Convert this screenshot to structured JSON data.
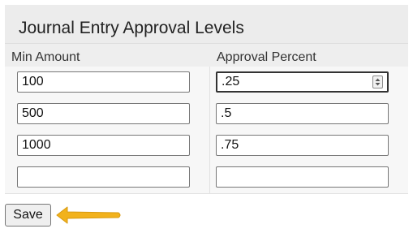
{
  "panel": {
    "title": "Journal Entry Approval Levels",
    "columns": {
      "min_amount": "Min Amount",
      "approval_percent": "Approval Percent"
    },
    "rows": [
      {
        "min_amount": "100",
        "approval_percent": ".25"
      },
      {
        "min_amount": "500",
        "approval_percent": ".5"
      },
      {
        "min_amount": "1000",
        "approval_percent": ".75"
      },
      {
        "min_amount": "",
        "approval_percent": ""
      }
    ]
  },
  "actions": {
    "save_label": "Save"
  },
  "colors": {
    "arrow": "#f2b21c",
    "panel_background": "#ececec"
  },
  "icons": {
    "number_spinner": "spinner-icon",
    "pointer_arrow": "arrow-left-icon"
  }
}
